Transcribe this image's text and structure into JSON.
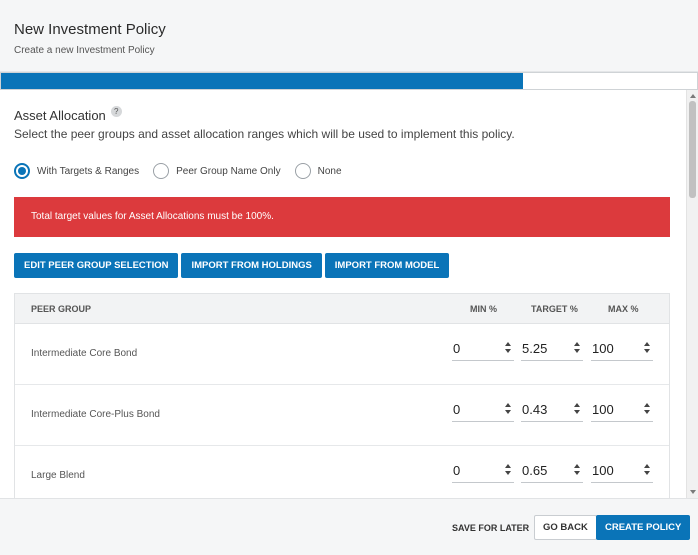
{
  "header": {
    "title": "New Investment Policy",
    "subtitle": "Create a new Investment Policy"
  },
  "progress": {
    "value_percent": 75
  },
  "section": {
    "title": "Asset Allocation",
    "help_icon": "question-icon",
    "description": "Select the peer groups and asset allocation ranges which will be used to implement this policy."
  },
  "radios": [
    {
      "label": "With Targets & Ranges",
      "checked": true
    },
    {
      "label": "Peer Group Name Only",
      "checked": false
    },
    {
      "label": "None",
      "checked": false
    }
  ],
  "alert": {
    "text": "Total target values for Asset Allocations must be 100%.",
    "color": "#dc3a3d"
  },
  "buttons": {
    "edit": "EDIT PEER GROUP SELECTION",
    "import_holdings": "IMPORT FROM HOLDINGS",
    "import_model": "IMPORT FROM MODEL"
  },
  "table": {
    "headers": {
      "peer_group": "PEER GROUP",
      "min": "MIN %",
      "target": "TARGET %",
      "max": "MAX %"
    },
    "rows": [
      {
        "name": "Intermediate Core Bond",
        "min": "0",
        "target": "5.25",
        "max": "100"
      },
      {
        "name": "Intermediate Core-Plus Bond",
        "min": "0",
        "target": "0.43",
        "max": "100"
      },
      {
        "name": "Large Blend",
        "min": "0",
        "target": "0.65",
        "max": "100"
      }
    ]
  },
  "footer": {
    "save_later": "SAVE FOR LATER",
    "go_back": "GO BACK",
    "create": "CREATE POLICY"
  },
  "colors": {
    "accent": "#0a74b8",
    "error": "#dc3a3d"
  }
}
